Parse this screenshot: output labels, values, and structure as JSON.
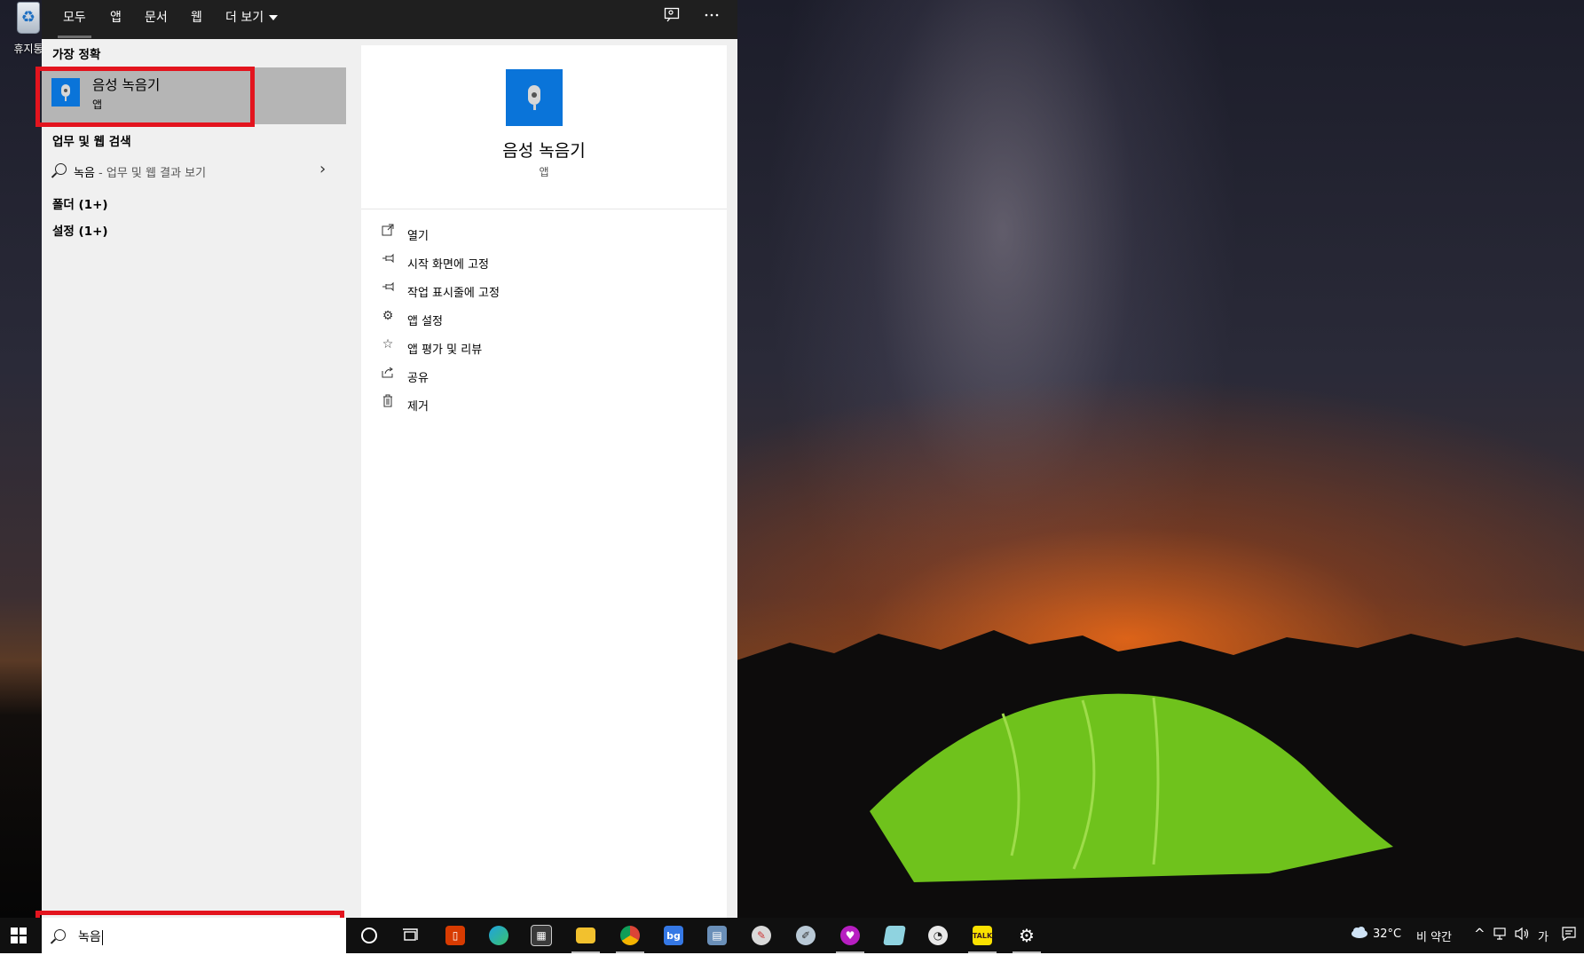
{
  "desktop": {
    "recycle_bin_label": "휴지통"
  },
  "search": {
    "filters": [
      "모두",
      "앱",
      "문서",
      "웹"
    ],
    "more_filters_label": "더 보기",
    "best_match_header": "가장 정확",
    "best_match": {
      "name": "음성 녹음기",
      "type": "앱"
    },
    "web_header": "업무 및 웹 검색",
    "web_query": "녹음",
    "web_hint": " - 업무 및 웹 결과 보기",
    "folders_header": "폴더 (1+)",
    "settings_header": "설정 (1+)",
    "query": "녹음"
  },
  "detail": {
    "name": "음성 녹음기",
    "type": "앱",
    "actions": [
      {
        "label": "열기",
        "icon": "open-icon"
      },
      {
        "label": "시작 화면에 고정",
        "icon": "pin-icon"
      },
      {
        "label": "작업 표시줄에 고정",
        "icon": "pin-icon"
      },
      {
        "label": "앱 설정",
        "icon": "gear-icon"
      },
      {
        "label": "앱 평가 및 리뷰",
        "icon": "star-icon"
      },
      {
        "label": "공유",
        "icon": "share-icon"
      },
      {
        "label": "제거",
        "icon": "trash-icon"
      }
    ]
  },
  "taskbar": {
    "weather_temp": "32°C",
    "weather_text": "비 약간",
    "ime": "가"
  },
  "colors": {
    "highlight": "#e3141e",
    "accent_blue": "#0a74d9",
    "selected_row": "#b5b5b5"
  }
}
